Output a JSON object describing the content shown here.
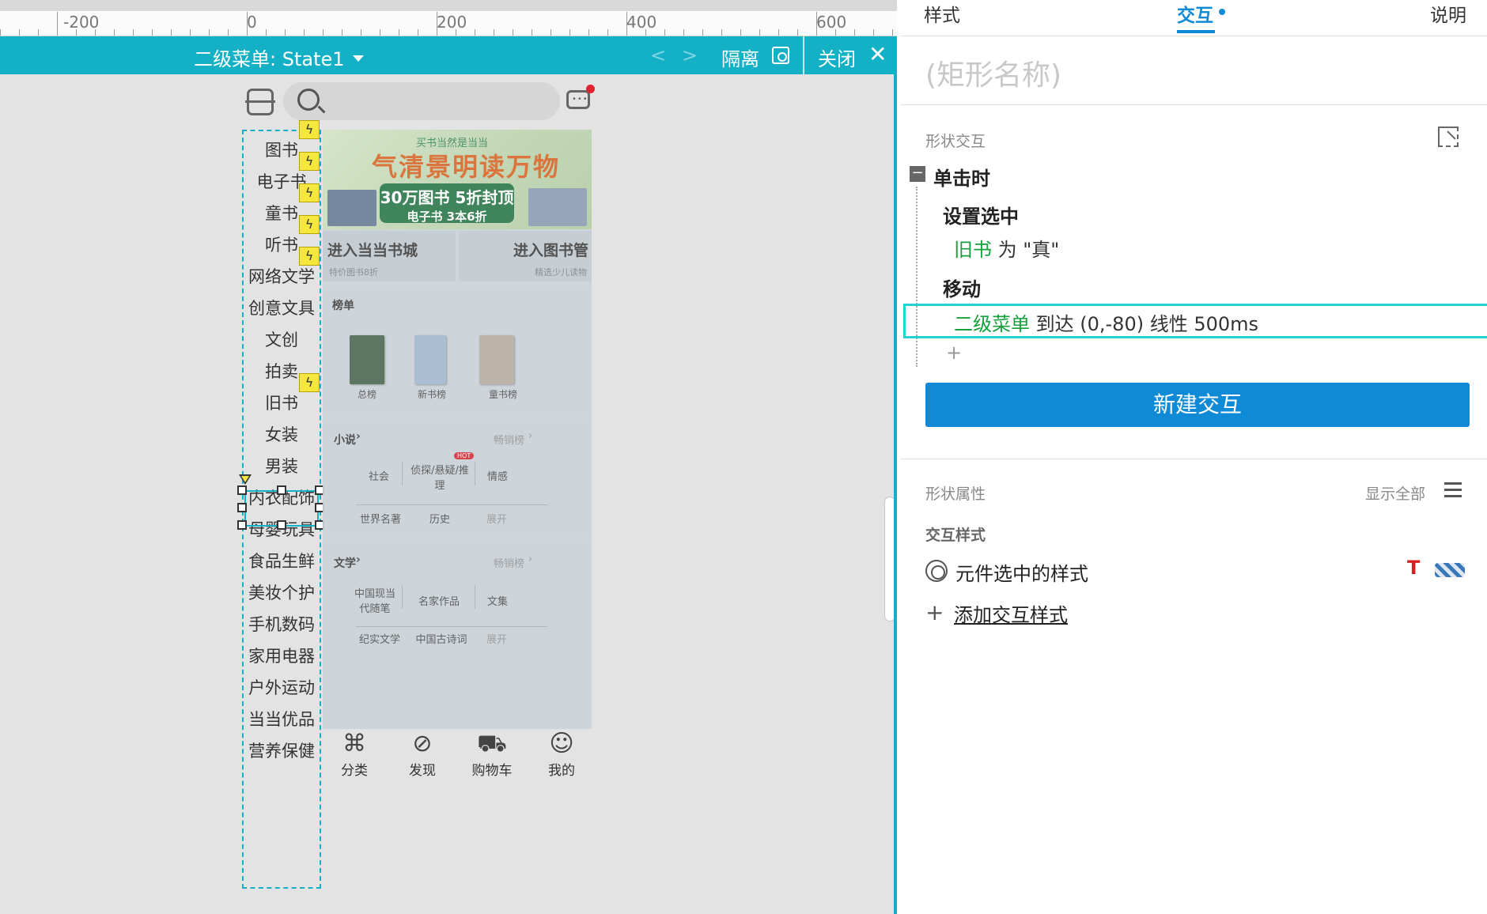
{
  "ruler": {
    "labels": [
      "-200",
      "0",
      "200",
      "400",
      "600"
    ]
  },
  "state_bar": {
    "title": "二级菜单: State1",
    "nav_prev": "<",
    "nav_next": ">",
    "isolate_label": "隔离",
    "close_label": "关闭",
    "close_glyph": "✕"
  },
  "phone": {
    "categories": [
      "图书",
      "电子书",
      "童书",
      "听书",
      "网络文学",
      "创意文具",
      "文创",
      "拍卖",
      "旧书",
      "女装",
      "男装",
      "内衣配饰",
      "母婴玩具",
      "食品生鲜",
      "美妆个护",
      "手机数码",
      "家用电器",
      "户外运动",
      "当当优品",
      "营养保健"
    ],
    "selected_category": "旧书",
    "banner": {
      "tag": "买书当然是当当",
      "headline": "气清景明读万物",
      "line1": "30万图书 5折封顶",
      "line2": "电子书 3本6折"
    },
    "entries": [
      {
        "title": "进入当当书城",
        "sub": "特价图书8折"
      },
      {
        "title": "进入图书管",
        "sub": "精选少儿读物"
      }
    ],
    "rank_section": {
      "title": "榜单",
      "items": [
        "总榜",
        "新书榜",
        "童书榜"
      ]
    },
    "novel_section": {
      "title": "小说",
      "more": "畅销榜",
      "hot_badge": "HOT",
      "row1": [
        "社会",
        "侦探/悬疑/推理",
        "情感"
      ],
      "row2": [
        "世界名著",
        "历史",
        "展开"
      ]
    },
    "lit_section": {
      "title": "文学",
      "more": "畅销榜",
      "row1": [
        "中国现当代随笔",
        "名家作品",
        "文集"
      ],
      "row2": [
        "纪实文学",
        "中国古诗词",
        "展开"
      ]
    },
    "tabs": [
      {
        "label": "分类",
        "icon": "grid-icon"
      },
      {
        "label": "发现",
        "icon": "compass-icon"
      },
      {
        "label": "购物车",
        "icon": "cart-icon"
      },
      {
        "label": "我的",
        "icon": "user-icon"
      }
    ]
  },
  "panel": {
    "tabs": {
      "style": "样式",
      "interaction": "交互",
      "notes": "说明"
    },
    "shape_name_placeholder": "(矩形名称)",
    "shape_interaction_title": "形状交互",
    "event": {
      "toggle": "−",
      "label": "单击时"
    },
    "action1": {
      "title": "设置选中",
      "target": "旧书",
      "mid": " 为 ",
      "value": "\"真\""
    },
    "action2": {
      "title": "移动",
      "target": "二级菜单",
      "detail": " 到达 (0,-80) 线性 500ms"
    },
    "add_action": "+",
    "new_interaction_button": "新建交互",
    "shape_props_title": "形状属性",
    "show_all": "显示全部",
    "interaction_style_title": "交互样式",
    "selected_style_label": "元件选中的样式",
    "text_style_glyph": "T",
    "add_style_plus": "+",
    "add_style_label": "添加交互样式"
  },
  "colors": {
    "accent": "#14b1c6",
    "primary_button": "#0f8ad6",
    "highlight": "#22d1d4",
    "green_text": "#15a03c"
  }
}
